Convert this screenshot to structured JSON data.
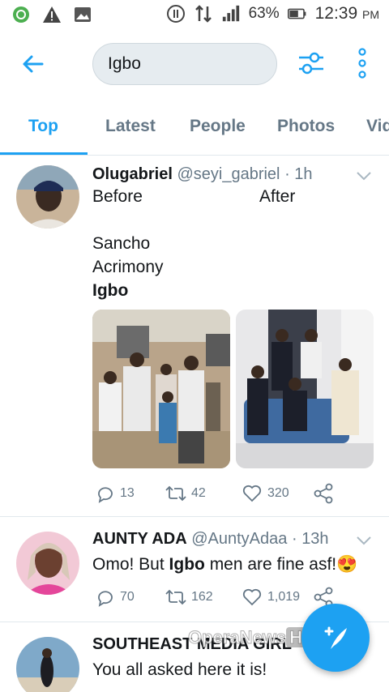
{
  "status_bar": {
    "battery": "63%",
    "time": "12:39",
    "ampm": "PM"
  },
  "header": {
    "search_value": "Igbo"
  },
  "tabs": [
    {
      "label": "Top",
      "active": true
    },
    {
      "label": "Latest",
      "active": false
    },
    {
      "label": "People",
      "active": false
    },
    {
      "label": "Photos",
      "active": false
    },
    {
      "label": "Vid",
      "active": false
    }
  ],
  "tweets": [
    {
      "name": "Olugabriel",
      "handle": "@seyi_gabriel",
      "dot": "·",
      "time": "1h",
      "lines": {
        "l1a": "Before",
        "l1b": "After",
        "l2": "Sancho",
        "l3": "Acrimony",
        "l4": "Igbo"
      },
      "replies": "13",
      "retweets": "42",
      "likes": "320"
    },
    {
      "name": "AUNTY ADA",
      "handle": "@AuntyAdaa",
      "dot": "·",
      "time": "13h",
      "text_pre": "Omo! But ",
      "text_bold": "Igbo",
      "text_post": " men are fine asf!😍",
      "replies": "70",
      "retweets": "162",
      "likes": "1,019"
    },
    {
      "name": "SOUTHEAST MEDIA GIRL",
      "text": "You all asked here it is!"
    }
  ],
  "watermark": {
    "text": "OperaNews",
    "hub": "Hub"
  },
  "colors": {
    "accent": "#1da1f2",
    "muted": "#657786",
    "divider": "#e1e8ed"
  }
}
